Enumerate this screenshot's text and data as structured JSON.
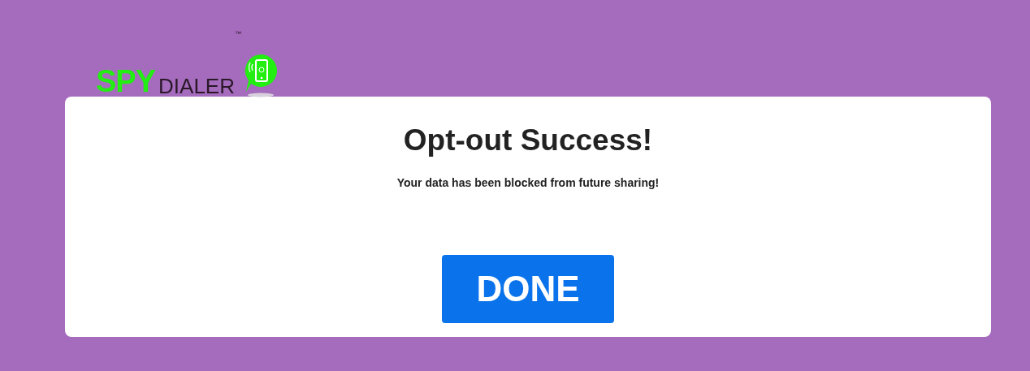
{
  "logo": {
    "brand_first": "SPY",
    "brand_second": "DIALER",
    "trademark": "™"
  },
  "card": {
    "title": "Opt-out Success!",
    "message": "Your data has been blocked from future sharing!",
    "button": "DONE"
  }
}
